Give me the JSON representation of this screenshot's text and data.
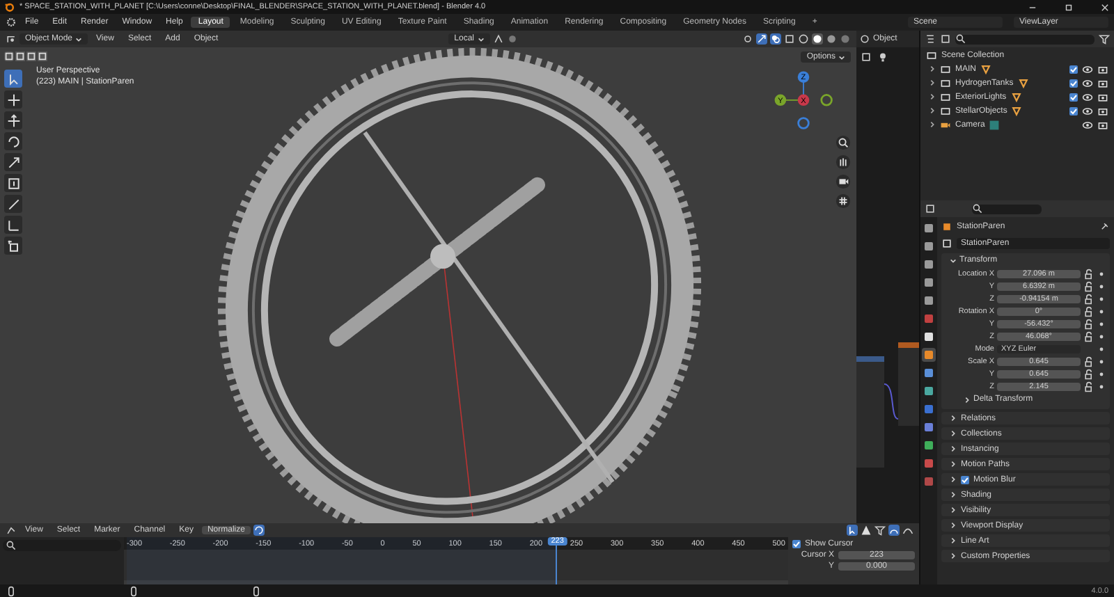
{
  "window": {
    "title": "* SPACE_STATION_WITH_PLANET [C:\\Users\\conne\\Desktop\\FINAL_BLENDER\\SPACE_STATION_WITH_PLANET.blend] - Blender 4.0"
  },
  "menu": [
    "File",
    "Edit",
    "Render",
    "Window",
    "Help"
  ],
  "workspaces": [
    {
      "label": "Layout",
      "selected": true
    },
    {
      "label": "Modeling",
      "selected": false
    },
    {
      "label": "Sculpting",
      "selected": false
    },
    {
      "label": "UV Editing",
      "selected": false
    },
    {
      "label": "Texture Paint",
      "selected": false
    },
    {
      "label": "Shading",
      "selected": false
    },
    {
      "label": "Animation",
      "selected": false
    },
    {
      "label": "Rendering",
      "selected": false
    },
    {
      "label": "Compositing",
      "selected": false
    },
    {
      "label": "Geometry Nodes",
      "selected": false
    },
    {
      "label": "Scripting",
      "selected": false
    }
  ],
  "add_workspace": "+",
  "scene": "Scene",
  "view_layer": "ViewLayer",
  "viewport": {
    "mode": "Object Mode",
    "menus": [
      "View",
      "Select",
      "Add",
      "Object"
    ],
    "orientation": "Local",
    "options": "Options",
    "info": [
      "User Perspective",
      "(223) MAIN | StationParen"
    ],
    "toolbar": [
      {
        "kind": "select",
        "selected": true
      },
      {
        "kind": "cursor",
        "selected": false
      },
      {
        "kind": "move",
        "selected": false
      },
      {
        "kind": "rotate",
        "selected": false
      },
      {
        "kind": "scale",
        "selected": false
      },
      {
        "kind": "transform",
        "selected": false
      },
      {
        "kind": "annotate",
        "selected": false
      },
      {
        "kind": "measure",
        "selected": false
      },
      {
        "kind": "add",
        "selected": false
      }
    ],
    "gizmo": [
      "Z",
      "Y",
      "X"
    ]
  },
  "node_editor": {
    "header": "Object"
  },
  "outliner": {
    "root": "Scene Collection",
    "items": [
      {
        "name": "MAIN",
        "kind": "collection",
        "checked": true
      },
      {
        "name": "HydrogenTanks",
        "kind": "collection",
        "checked": true
      },
      {
        "name": "ExteriorLights",
        "kind": "collection",
        "checked": true
      },
      {
        "name": "StellarObjects",
        "kind": "collection",
        "checked": true
      },
      {
        "name": "Camera",
        "kind": "camera"
      }
    ]
  },
  "properties": {
    "object_name": "StationParen",
    "data_name": "StationParen",
    "tabs": [
      {
        "kind": "tool",
        "selected": false
      },
      {
        "kind": "render",
        "selected": false
      },
      {
        "kind": "output",
        "selected": false
      },
      {
        "kind": "view",
        "selected": false
      },
      {
        "kind": "scene",
        "selected": false
      },
      {
        "kind": "world",
        "selected": false
      },
      {
        "kind": "collection",
        "selected": false
      },
      {
        "kind": "object",
        "selected": true
      },
      {
        "kind": "modifier",
        "selected": false
      },
      {
        "kind": "particles",
        "selected": false
      },
      {
        "kind": "physics",
        "selected": false
      },
      {
        "kind": "constraint",
        "selected": false
      },
      {
        "kind": "data",
        "selected": false
      },
      {
        "kind": "material",
        "selected": false
      },
      {
        "kind": "texture",
        "selected": false
      }
    ],
    "transform": {
      "title": "Transform",
      "rows": [
        {
          "label": "Location X",
          "value": "27.096 m",
          "kind": "field"
        },
        {
          "label": "Y",
          "value": "6.6392 m",
          "kind": "field"
        },
        {
          "label": "Z",
          "value": "-0.94154 m",
          "kind": "field"
        },
        {
          "label": "Rotation X",
          "value": "0°",
          "kind": "field"
        },
        {
          "label": "Y",
          "value": "-56.432°",
          "kind": "field"
        },
        {
          "label": "Z",
          "value": "46.068°",
          "kind": "field"
        },
        {
          "label": "Mode",
          "value": "XYZ Euler",
          "kind": "dropdown"
        },
        {
          "label": "Scale X",
          "value": "0.645",
          "kind": "field"
        },
        {
          "label": "Y",
          "value": "0.645",
          "kind": "field"
        },
        {
          "label": "Z",
          "value": "2.145",
          "kind": "field"
        }
      ],
      "delta": "Delta Transform"
    },
    "panels": [
      {
        "title": "Relations",
        "kind": "plain"
      },
      {
        "title": "Collections",
        "kind": "plain"
      },
      {
        "title": "Instancing",
        "kind": "plain"
      },
      {
        "title": "Motion Paths",
        "kind": "plain"
      },
      {
        "title": "Motion Blur",
        "kind": "checkbox",
        "checked": true
      },
      {
        "title": "Shading",
        "kind": "plain"
      },
      {
        "title": "Visibility",
        "kind": "plain"
      },
      {
        "title": "Viewport Display",
        "kind": "plain"
      },
      {
        "title": "Line Art",
        "kind": "plain"
      },
      {
        "title": "Custom Properties",
        "kind": "plain"
      }
    ]
  },
  "timeline": {
    "menus": [
      "View",
      "Select",
      "Marker",
      "Channel",
      "Key"
    ],
    "normalize": "Normalize",
    "ticks": [
      "-300",
      "-250",
      "-200",
      "-150",
      "-100",
      "-50",
      "0",
      "50",
      "100",
      "150",
      "200",
      "250",
      "300",
      "350",
      "400",
      "450",
      "500"
    ],
    "current_frame": {
      "label": "223",
      "level": 0.654
    },
    "cursor_panel": {
      "title": "Show Cursor",
      "checked": true,
      "fields": [
        {
          "label": "Cursor X",
          "value": "223"
        },
        {
          "label": "Y",
          "value": "0.000"
        }
      ]
    }
  },
  "status_bar": {
    "version": "4.0.0"
  }
}
